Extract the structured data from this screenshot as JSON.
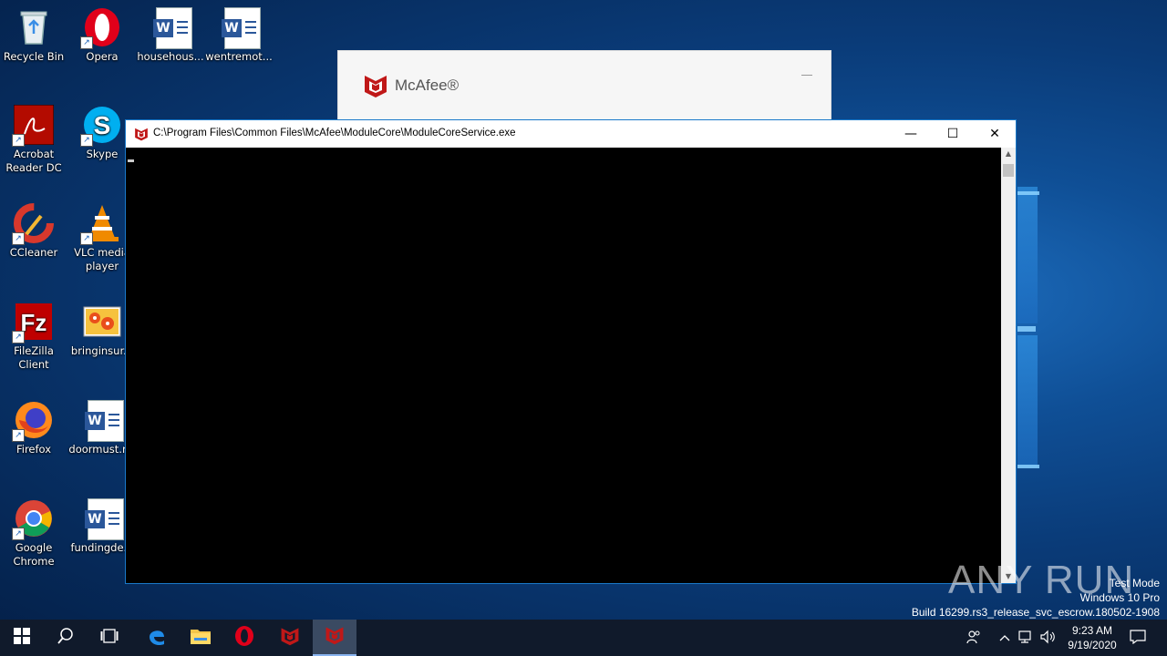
{
  "desktop": {
    "icons": [
      {
        "label": "Recycle Bin"
      },
      {
        "label": "Opera"
      },
      {
        "label": "househous..."
      },
      {
        "label": "wentremot..."
      },
      {
        "label": "Acrobat Reader DC"
      },
      {
        "label": "Skype"
      },
      {
        "label": "CCleaner"
      },
      {
        "label": "VLC media player"
      },
      {
        "label": "FileZilla Client"
      },
      {
        "label": "bringinsur..."
      },
      {
        "label": "Firefox"
      },
      {
        "label": "doormust.r..."
      },
      {
        "label": "Google Chrome"
      },
      {
        "label": "fundingde..."
      }
    ]
  },
  "mcafee_window": {
    "brand": "McAfee®"
  },
  "console_window": {
    "title": "C:\\Program Files\\Common Files\\McAfee\\ModuleCore\\ModuleCoreService.exe",
    "minimize": "—",
    "maximize": "☐",
    "close": "✕"
  },
  "watermark": {
    "line1": "Test Mode",
    "line2": "Windows 10 Pro",
    "line3": "Build 16299.rs3_release_svc_escrow.180502-1908",
    "logo": "ANY RUN"
  },
  "taskbar": {
    "time": "9:23 AM",
    "date": "9/19/2020"
  },
  "colors": {
    "desktop_bg": "#0a3b78",
    "taskbar_bg": "#101a2b",
    "mcafee_red": "#c01818",
    "window_border": "#1979ca"
  }
}
